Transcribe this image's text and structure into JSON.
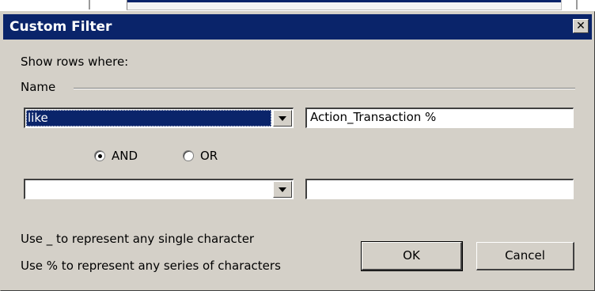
{
  "dialog": {
    "title": "Custom Filter",
    "close_label": "✕"
  },
  "labels": {
    "show_rows": "Show rows where:",
    "field_name": "Name"
  },
  "row1": {
    "operator_value": "like",
    "text_value": "Action_Transaction %"
  },
  "logic": {
    "and_label": "AND",
    "or_label": "OR",
    "selected": "AND"
  },
  "row2": {
    "operator_value": "",
    "text_value": ""
  },
  "hints": {
    "line1": "Use _ to represent any single character",
    "line2": "Use % to represent any series of characters"
  },
  "buttons": {
    "ok_label": "OK",
    "cancel_label": "Cancel"
  },
  "colors": {
    "titlebar": "#0a246a",
    "dialog_bg": "#d4d0c8",
    "selection": "#0a246a"
  }
}
